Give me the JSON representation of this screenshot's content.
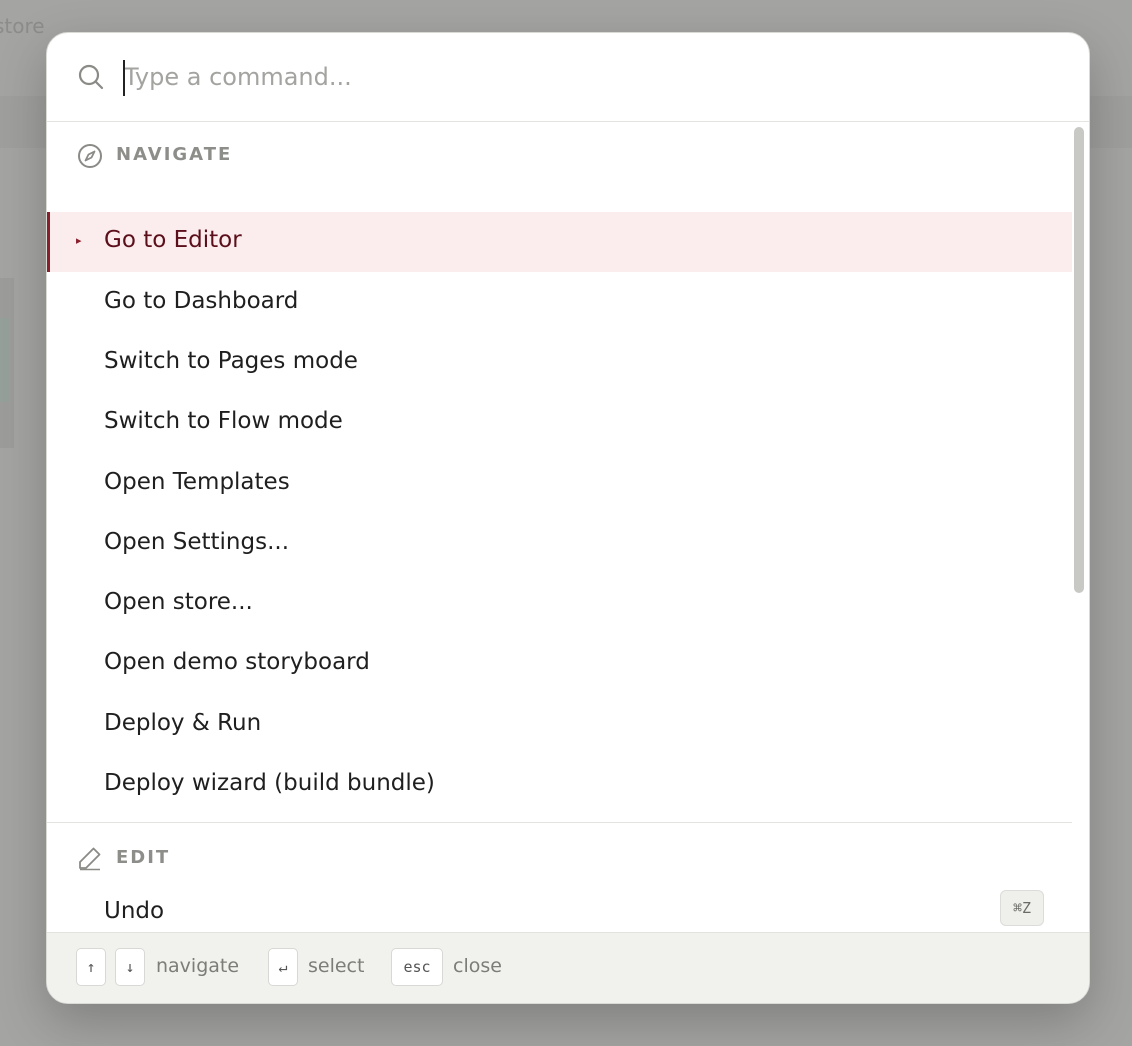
{
  "background": {
    "app_text": "store"
  },
  "search": {
    "placeholder": "Type a command..."
  },
  "sections": {
    "navigate": {
      "title": "NAVIGATE",
      "items": [
        {
          "label": "Go to Editor"
        },
        {
          "label": "Go to Dashboard"
        },
        {
          "label": "Switch to Pages mode"
        },
        {
          "label": "Switch to Flow mode"
        },
        {
          "label": "Open Templates"
        },
        {
          "label": "Open Settings..."
        },
        {
          "label": "Open store..."
        },
        {
          "label": "Open demo storyboard"
        },
        {
          "label": "Deploy & Run"
        },
        {
          "label": "Deploy wizard (build bundle)"
        }
      ]
    },
    "edit": {
      "title": "EDIT",
      "items": [
        {
          "label": "Undo",
          "shortcut": "⌘Z"
        }
      ]
    }
  },
  "footer": {
    "up_key": "↑",
    "down_key": "↓",
    "navigate_label": "navigate",
    "enter_key": "↵",
    "select_label": "select",
    "esc_key": "esc",
    "close_label": "close"
  },
  "colors": {
    "accent": "#8a1f2c",
    "active_bg": "#fbeced",
    "overlay": "#a4a4a2"
  }
}
